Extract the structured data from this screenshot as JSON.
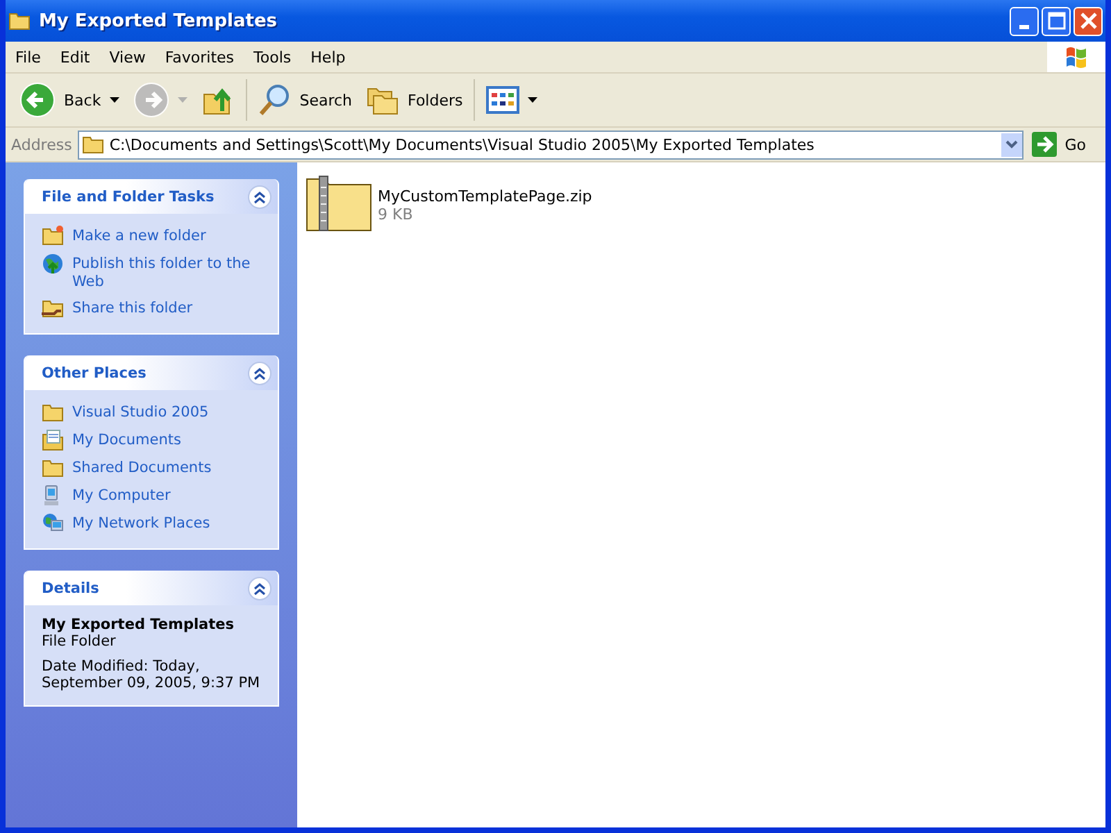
{
  "window": {
    "title": "My Exported Templates"
  },
  "menu": [
    "File",
    "Edit",
    "View",
    "Favorites",
    "Tools",
    "Help"
  ],
  "toolbar": [
    {
      "kind": "back",
      "label": "Back",
      "disabled": false
    },
    {
      "kind": "forward",
      "disabled": true
    },
    {
      "kind": "up",
      "disabled": false
    },
    {
      "kind": "search",
      "label": "Search",
      "disabled": false
    },
    {
      "kind": "folders",
      "label": "Folders",
      "disabled": false
    },
    {
      "kind": "views",
      "disabled": false
    }
  ],
  "address": {
    "label": "Address",
    "value": "C:\\Documents and Settings\\Scott\\My Documents\\Visual Studio 2005\\My Exported Templates",
    "go": "Go"
  },
  "panels": [
    {
      "kind": "links",
      "title": "File and Folder Tasks",
      "expanded": true,
      "items": [
        {
          "kind": "new-folder",
          "label": "Make a new folder"
        },
        {
          "kind": "globe",
          "label": "Publish this folder to the Web"
        },
        {
          "kind": "share",
          "label": "Share this folder"
        }
      ]
    },
    {
      "kind": "links",
      "title": "Other Places",
      "expanded": true,
      "items": [
        {
          "kind": "folder",
          "label": "Visual Studio 2005"
        },
        {
          "kind": "documents",
          "label": "My Documents"
        },
        {
          "kind": "folder",
          "label": "Shared Documents"
        },
        {
          "kind": "computer",
          "label": "My Computer"
        },
        {
          "kind": "network",
          "label": "My Network Places"
        }
      ]
    },
    {
      "kind": "details",
      "title": "Details",
      "expanded": true,
      "name": "My Exported Templates",
      "type": "File Folder",
      "modified": "Date Modified: Today, September 09, 2005, 9:37 PM"
    }
  ],
  "files": [
    {
      "name": "MyCustomTemplatePage.zip",
      "size": "9 KB",
      "selected": false
    }
  ]
}
